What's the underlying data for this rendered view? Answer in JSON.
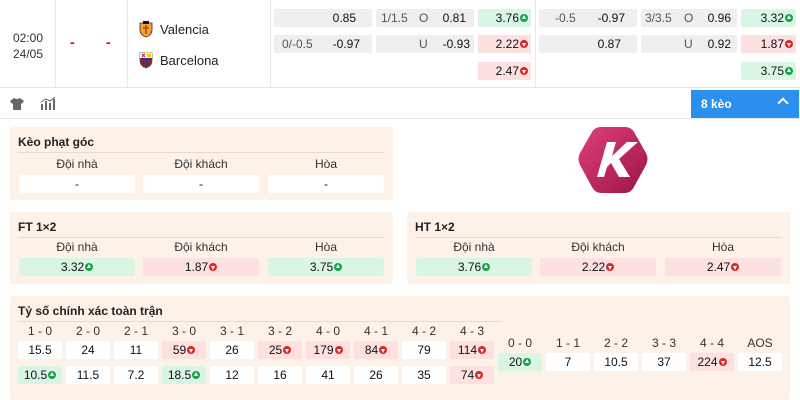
{
  "match": {
    "time": "02:00",
    "date": "24/05",
    "score_home": "-",
    "score_away": "-",
    "home_team": "Valencia",
    "away_team": "Barcelona",
    "odds": {
      "r1": {
        "a": "0.85",
        "b_line": "1/1.5",
        "b_side": "O",
        "b_val": "0.81",
        "c": "3.76",
        "d_line": "-0.5",
        "d_val": "-0.97",
        "e_line": "3/3.5",
        "e_side": "O",
        "e_val": "0.96",
        "f": "3.32"
      },
      "r2": {
        "a_line": "0/-0.5",
        "a_val": "-0.97",
        "b_side": "U",
        "b_val": "-0.93",
        "c": "2.22",
        "d_val": "0.87",
        "e_side": "U",
        "e_val": "0.92",
        "f": "1.87"
      },
      "r3": {
        "c": "2.47",
        "f": "3.75"
      }
    }
  },
  "toolbar": {
    "more_label": "8 kèo"
  },
  "corner": {
    "title": "Kèo phạt góc",
    "headers": [
      "Đội nhà",
      "Đội khách",
      "Hòa"
    ],
    "values": [
      "-",
      "-",
      "-"
    ]
  },
  "ft": {
    "title": "FT 1×2",
    "headers": [
      "Đội nhà",
      "Đội khách",
      "Hòa"
    ],
    "values": [
      "3.32",
      "1.87",
      "3.75"
    ]
  },
  "ht": {
    "title": "HT 1×2",
    "headers": [
      "Đội nhà",
      "Đội khách",
      "Hòa"
    ],
    "values": [
      "3.76",
      "2.22",
      "2.47"
    ]
  },
  "correct_score": {
    "title": "Tỷ số chính xác toàn trận",
    "home_heads": [
      "1 - 0",
      "2 - 0",
      "2 - 1",
      "3 - 0",
      "3 - 1",
      "3 - 2",
      "4 - 0",
      "4 - 1",
      "4 - 2",
      "4 - 3"
    ],
    "home_vals": [
      "15.5",
      "24",
      "11",
      "59",
      "26",
      "25",
      "179",
      "84",
      "79",
      "114"
    ],
    "away_vals": [
      "10.5",
      "11.5",
      "7.2",
      "18.5",
      "12",
      "16",
      "41",
      "26",
      "35",
      "74"
    ],
    "draw_heads": [
      "0 - 0",
      "1 - 1",
      "2 - 2",
      "3 - 3",
      "4 - 4",
      "AOS"
    ],
    "draw_vals": [
      "20",
      "7",
      "10.5",
      "37",
      "224",
      "12.5"
    ]
  },
  "colors": {
    "accent": "#2b8ff0",
    "logo": "#c2185b",
    "up": "#16a34a",
    "down": "#dc2626"
  },
  "icons": [
    "shirt-icon",
    "stats-icon",
    "chevron-up-icon",
    "brand-k-logo"
  ]
}
